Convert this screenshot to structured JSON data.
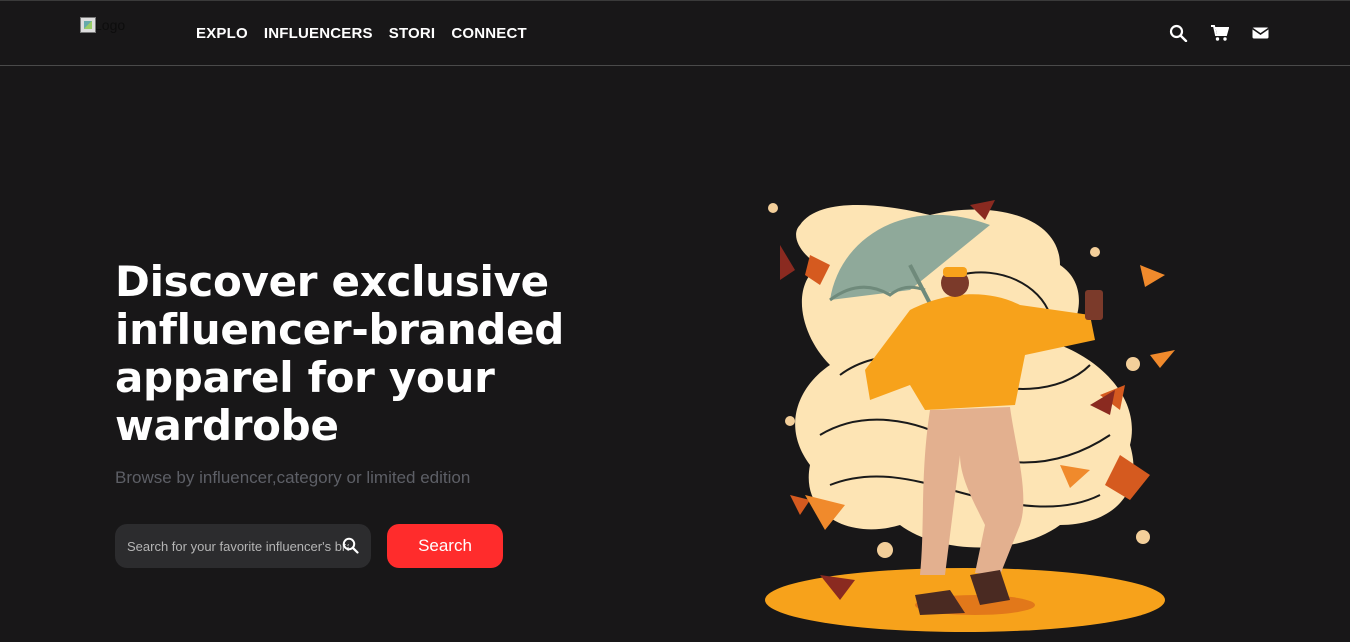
{
  "header": {
    "logo_alt": "Logo",
    "nav": [
      "EXPLO",
      "INFLUENCERS",
      "STORI",
      "CONNECT"
    ]
  },
  "icons": {
    "search": "search-icon",
    "cart": "cart-icon",
    "mail": "mail-icon"
  },
  "hero": {
    "title": "Discover exclusive influencer-branded apparel for your wardrobe",
    "subtitle": "Browse by influencer,category or limited edition",
    "search_placeholder": "Search for your favorite influencer's brand",
    "search_button": "Search"
  },
  "colors": {
    "background": "#181718",
    "accent": "#ff2c2c",
    "muted_text": "#5d5f66"
  }
}
